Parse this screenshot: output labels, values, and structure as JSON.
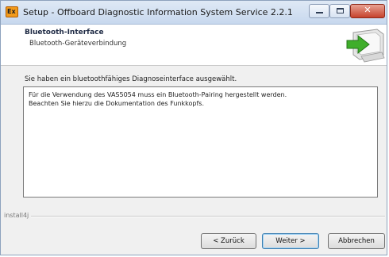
{
  "window": {
    "title": "Setup - Offboard Diagnostic Information System Service 2.2.1",
    "app_icon_text": "Ex"
  },
  "header": {
    "title": "Bluetooth-Interface",
    "subtitle": "Bluetooth-Geräteverbindung"
  },
  "content": {
    "label": "Sie haben ein bluetoothfähiges Diagnoseinterface ausgewählt.",
    "text_lines": [
      "Für die Verwendung des VAS5054 muss ein Bluetooth-Pairing hergestellt werden.",
      "Beachten Sie hierzu die Dokumentation des Funkkopfs."
    ]
  },
  "footer": {
    "brand": "install4j"
  },
  "buttons": {
    "back": "< Zurück",
    "next": "Weiter >",
    "cancel": "Abbrechen"
  }
}
